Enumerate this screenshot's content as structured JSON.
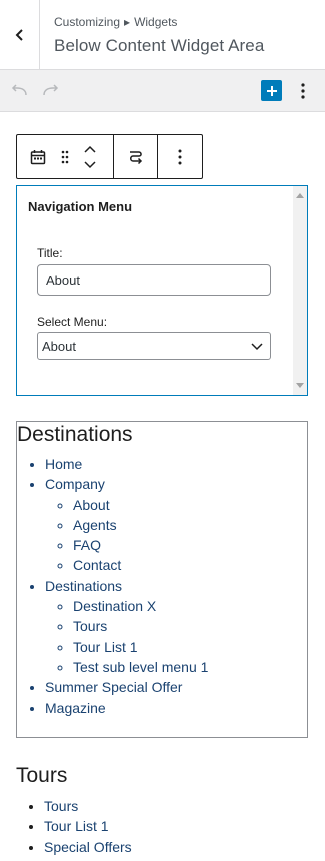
{
  "header": {
    "breadcrumb_parent": "Customizing",
    "breadcrumb_separator": "▸",
    "breadcrumb_child": "Widgets",
    "title": "Below Content Widget Area"
  },
  "toolbar": {
    "undo_icon": "undo-icon",
    "redo_icon": "redo-icon",
    "add_icon": "plus-icon",
    "more_icon": "vertical-ellipsis-icon"
  },
  "block_toolbar": {
    "icons": [
      "calendar-icon",
      "drag-handle-icon",
      "move-up-down-icon",
      "transform-icon",
      "options-icon"
    ]
  },
  "widget": {
    "title": "Navigation Menu",
    "title_label": "Title:",
    "title_value": "About",
    "menu_label": "Select Menu:",
    "menu_value": "About"
  },
  "preview": {
    "heading": "Destinations",
    "menu": [
      {
        "label": "Home",
        "children": []
      },
      {
        "label": "Company",
        "children": [
          "About",
          "Agents",
          "FAQ",
          "Contact"
        ]
      },
      {
        "label": "Destinations",
        "children": [
          "Destination X",
          "Tours",
          "Tour List 1",
          "Test sub level menu 1"
        ]
      },
      {
        "label": "Summer Special Offer",
        "children": []
      },
      {
        "label": "Magazine",
        "children": []
      }
    ]
  },
  "tours": {
    "heading": "Tours",
    "items": [
      "Tours",
      "Tour List 1",
      "Special Offers"
    ]
  },
  "colors": {
    "accent": "#007cba",
    "link": "#1a4270",
    "toolbar_bg": "#f0f0f1"
  }
}
